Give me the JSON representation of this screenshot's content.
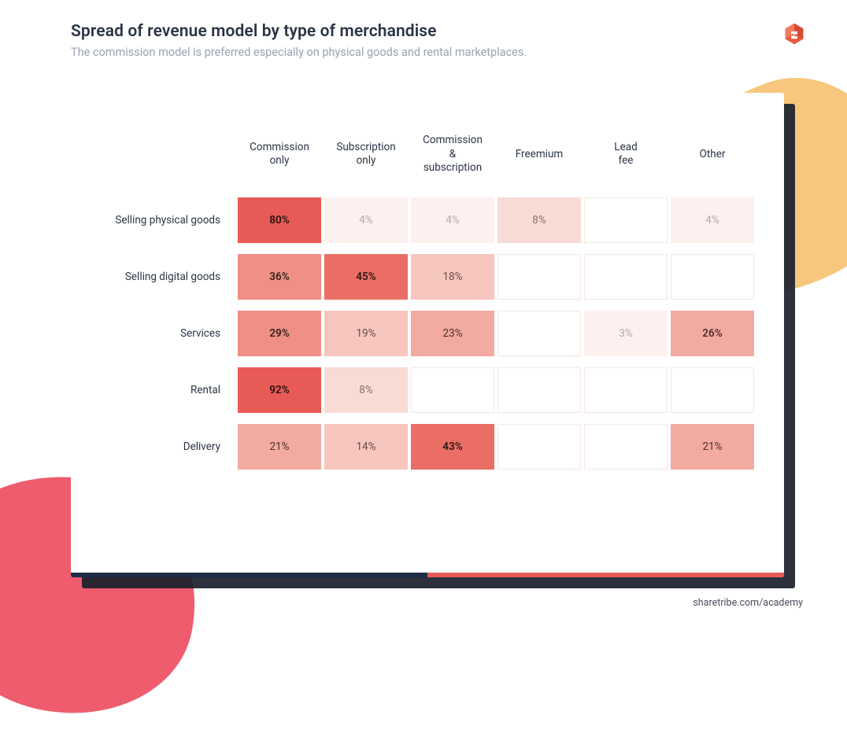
{
  "header": {
    "title": "Spread of revenue model by type of merchandise",
    "subtitle": "The commission model is preferred especially on physical goods and rental marketplaces."
  },
  "footer_link": "sharetribe.com/academy",
  "logo_name": "sharetribe-logo",
  "chart_data": {
    "type": "heatmap",
    "title": "Spread of revenue model by type of merchandise",
    "xlabel": "",
    "ylabel": "",
    "columns": [
      "Commission only",
      "Subscription only",
      "Commission & subscription",
      "Freemium",
      "Lead fee",
      "Other"
    ],
    "rows": [
      "Selling physical goods",
      "Selling digital goods",
      "Services",
      "Rental",
      "Delivery"
    ],
    "values": [
      [
        80,
        4,
        4,
        8,
        null,
        4
      ],
      [
        36,
        45,
        18,
        null,
        null,
        null
      ],
      [
        29,
        19,
        23,
        null,
        3,
        26
      ],
      [
        92,
        8,
        null,
        null,
        null,
        null
      ],
      [
        21,
        14,
        43,
        null,
        null,
        21
      ]
    ],
    "value_suffix": "%",
    "palette": {
      "empty": "#ffffff",
      "scale": [
        {
          "max": 5,
          "bg": "#fdf1ef",
          "fg": "#b7a9a7"
        },
        {
          "max": 12,
          "bg": "#f9dbd5",
          "fg": "#8d6d68"
        },
        {
          "max": 20,
          "bg": "#f6c6bf",
          "fg": "#6e4c47"
        },
        {
          "max": 26,
          "bg": "#f3aaa0",
          "fg": "#4a2f2b"
        },
        {
          "max": 40,
          "bg": "#ef8f85",
          "fg": "#34201d"
        },
        {
          "max": 60,
          "bg": "#ea6e65",
          "fg": "#2a1714"
        },
        {
          "max": 100,
          "bg": "#e85a56",
          "fg": "#26110f"
        }
      ]
    }
  }
}
